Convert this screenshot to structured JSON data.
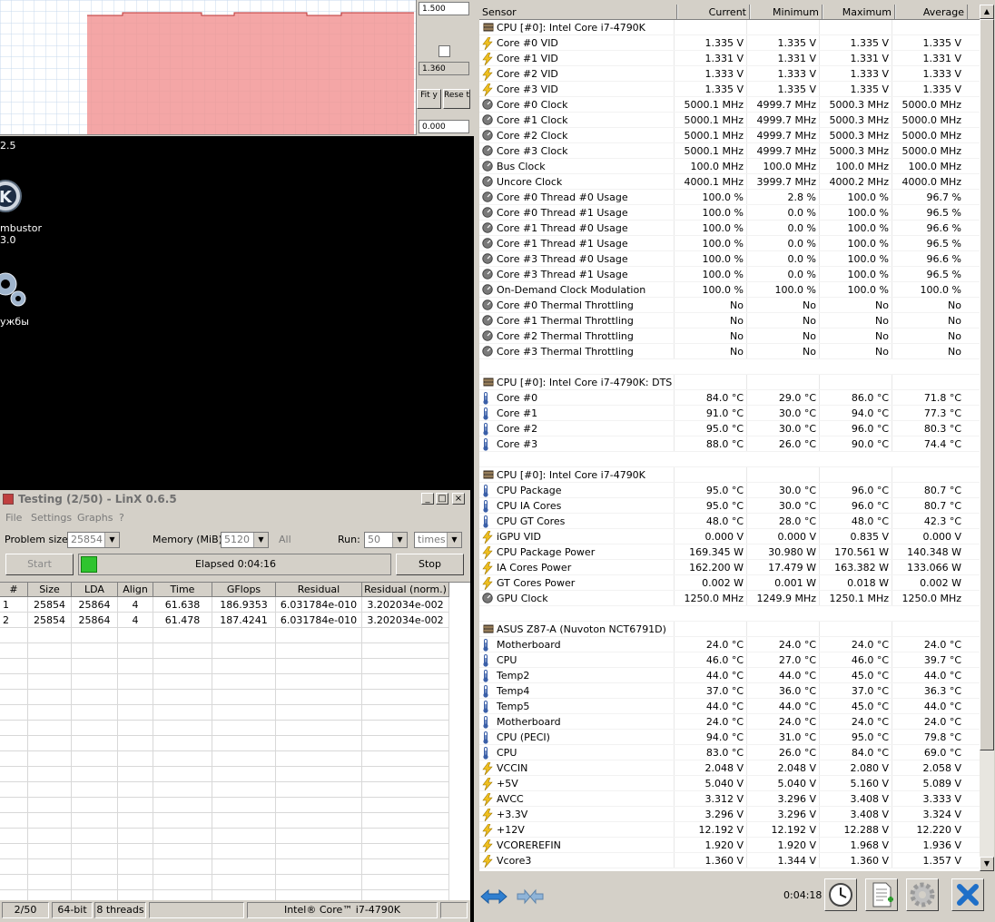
{
  "graph": {
    "top_value": "1.500",
    "current_value": "1.360",
    "bottom_value": "0.000",
    "fit_y_label": "Fit y",
    "reset_label": "Rese t"
  },
  "desktop": {
    "version_fragment": "2.5",
    "icon1_label_line1": "mbustor",
    "icon1_label_line2": "3.0",
    "icon2_label": "ужбы"
  },
  "linx": {
    "title": "Testing (2/50) - LinX 0.6.5",
    "menu": [
      "File",
      "Settings",
      "Graphs",
      "?"
    ],
    "problem_size_label": "Problem size:",
    "problem_size_value": "25854",
    "memory_label": "Memory (MiB):",
    "memory_value": "5120",
    "all_label": "All",
    "run_label": "Run:",
    "run_value": "50",
    "run_unit": "times",
    "start_label": "Start",
    "elapsed_label": "Elapsed 0:04:16",
    "stop_label": "Stop",
    "columns": [
      "#",
      "Size",
      "LDA",
      "Align",
      "Time",
      "GFlops",
      "Residual",
      "Residual (norm.)"
    ],
    "rows": [
      [
        "1",
        "25854",
        "25864",
        "4",
        "61.638",
        "186.9353",
        "6.031784e-010",
        "3.202034e-002"
      ],
      [
        "2",
        "25854",
        "25864",
        "4",
        "61.478",
        "187.4241",
        "6.031784e-010",
        "3.202034e-002"
      ]
    ],
    "status": {
      "progress": "2/50",
      "bits": "64-bit",
      "threads": "8 threads",
      "cpu": "Intel® Core™ i7-4790K"
    }
  },
  "hwinfo": {
    "columns": [
      "Sensor",
      "Current",
      "Minimum",
      "Maximum",
      "Average"
    ],
    "rows": [
      {
        "type": "group",
        "name": "CPU [#0]: Intel Core i7-4790K"
      },
      {
        "icon": "bolt",
        "name": "Core #0 VID",
        "v": [
          "1.335 V",
          "1.335 V",
          "1.335 V",
          "1.335 V"
        ]
      },
      {
        "icon": "bolt",
        "name": "Core #1 VID",
        "v": [
          "1.331 V",
          "1.331 V",
          "1.331 V",
          "1.331 V"
        ]
      },
      {
        "icon": "bolt",
        "name": "Core #2 VID",
        "v": [
          "1.333 V",
          "1.333 V",
          "1.333 V",
          "1.333 V"
        ]
      },
      {
        "icon": "bolt",
        "name": "Core #3 VID",
        "v": [
          "1.335 V",
          "1.335 V",
          "1.335 V",
          "1.335 V"
        ]
      },
      {
        "icon": "gauge",
        "name": "Core #0 Clock",
        "v": [
          "5000.1 MHz",
          "4999.7 MHz",
          "5000.3 MHz",
          "5000.0 MHz"
        ]
      },
      {
        "icon": "gauge",
        "name": "Core #1 Clock",
        "v": [
          "5000.1 MHz",
          "4999.7 MHz",
          "5000.3 MHz",
          "5000.0 MHz"
        ]
      },
      {
        "icon": "gauge",
        "name": "Core #2 Clock",
        "v": [
          "5000.1 MHz",
          "4999.7 MHz",
          "5000.3 MHz",
          "5000.0 MHz"
        ]
      },
      {
        "icon": "gauge",
        "name": "Core #3 Clock",
        "v": [
          "5000.1 MHz",
          "4999.7 MHz",
          "5000.3 MHz",
          "5000.0 MHz"
        ]
      },
      {
        "icon": "gauge",
        "name": "Bus Clock",
        "v": [
          "100.0 MHz",
          "100.0 MHz",
          "100.0 MHz",
          "100.0 MHz"
        ]
      },
      {
        "icon": "gauge",
        "name": "Uncore Clock",
        "v": [
          "4000.1 MHz",
          "3999.7 MHz",
          "4000.2 MHz",
          "4000.0 MHz"
        ]
      },
      {
        "icon": "gauge",
        "name": "Core #0 Thread #0 Usage",
        "v": [
          "100.0 %",
          "2.8 %",
          "100.0 %",
          "96.7 %"
        ]
      },
      {
        "icon": "gauge",
        "name": "Core #0 Thread #1 Usage",
        "v": [
          "100.0 %",
          "0.0 %",
          "100.0 %",
          "96.5 %"
        ]
      },
      {
        "icon": "gauge",
        "name": "Core #1 Thread #0 Usage",
        "v": [
          "100.0 %",
          "0.0 %",
          "100.0 %",
          "96.6 %"
        ]
      },
      {
        "icon": "gauge",
        "name": "Core #1 Thread #1 Usage",
        "v": [
          "100.0 %",
          "0.0 %",
          "100.0 %",
          "96.5 %"
        ]
      },
      {
        "icon": "gauge",
        "name": "Core #3 Thread #0 Usage",
        "v": [
          "100.0 %",
          "0.0 %",
          "100.0 %",
          "96.6 %"
        ]
      },
      {
        "icon": "gauge",
        "name": "Core #3 Thread #1 Usage",
        "v": [
          "100.0 %",
          "0.0 %",
          "100.0 %",
          "96.5 %"
        ]
      },
      {
        "icon": "gauge",
        "name": "On-Demand Clock Modulation",
        "v": [
          "100.0 %",
          "100.0 %",
          "100.0 %",
          "100.0 %"
        ]
      },
      {
        "icon": "gauge",
        "name": "Core #0 Thermal Throttling",
        "v": [
          "No",
          "No",
          "No",
          "No"
        ]
      },
      {
        "icon": "gauge",
        "name": "Core #1 Thermal Throttling",
        "v": [
          "No",
          "No",
          "No",
          "No"
        ]
      },
      {
        "icon": "gauge",
        "name": "Core #2 Thermal Throttling",
        "v": [
          "No",
          "No",
          "No",
          "No"
        ]
      },
      {
        "icon": "gauge",
        "name": "Core #3 Thermal Throttling",
        "v": [
          "No",
          "No",
          "No",
          "No"
        ]
      },
      {
        "type": "blank"
      },
      {
        "type": "group",
        "name": "CPU [#0]: Intel Core i7-4790K: DTS"
      },
      {
        "icon": "therm",
        "name": "Core #0",
        "v": [
          "84.0 °C",
          "29.0 °C",
          "86.0 °C",
          "71.8 °C"
        ]
      },
      {
        "icon": "therm",
        "name": "Core #1",
        "v": [
          "91.0 °C",
          "30.0 °C",
          "94.0 °C",
          "77.3 °C"
        ]
      },
      {
        "icon": "therm",
        "name": "Core #2",
        "v": [
          "95.0 °C",
          "30.0 °C",
          "96.0 °C",
          "80.3 °C"
        ]
      },
      {
        "icon": "therm",
        "name": "Core #3",
        "v": [
          "88.0 °C",
          "26.0 °C",
          "90.0 °C",
          "74.4 °C"
        ]
      },
      {
        "type": "blank"
      },
      {
        "type": "group",
        "name": "CPU [#0]: Intel Core i7-4790K"
      },
      {
        "icon": "therm",
        "name": "CPU Package",
        "v": [
          "95.0 °C",
          "30.0 °C",
          "96.0 °C",
          "80.7 °C"
        ]
      },
      {
        "icon": "therm",
        "name": "CPU IA Cores",
        "v": [
          "95.0 °C",
          "30.0 °C",
          "96.0 °C",
          "80.7 °C"
        ]
      },
      {
        "icon": "therm",
        "name": "CPU GT Cores",
        "v": [
          "48.0 °C",
          "28.0 °C",
          "48.0 °C",
          "42.3 °C"
        ]
      },
      {
        "icon": "bolt",
        "name": "iGPU VID",
        "v": [
          "0.000 V",
          "0.000 V",
          "0.835 V",
          "0.000 V"
        ]
      },
      {
        "icon": "bolt",
        "name": "CPU Package Power",
        "v": [
          "169.345 W",
          "30.980 W",
          "170.561 W",
          "140.348 W"
        ]
      },
      {
        "icon": "bolt",
        "name": "IA Cores Power",
        "v": [
          "162.200 W",
          "17.479 W",
          "163.382 W",
          "133.066 W"
        ]
      },
      {
        "icon": "bolt",
        "name": "GT Cores Power",
        "v": [
          "0.002 W",
          "0.001 W",
          "0.018 W",
          "0.002 W"
        ]
      },
      {
        "icon": "gauge",
        "name": "GPU Clock",
        "v": [
          "1250.0 MHz",
          "1249.9 MHz",
          "1250.1 MHz",
          "1250.0 MHz"
        ]
      },
      {
        "type": "blank"
      },
      {
        "type": "group",
        "name": "ASUS Z87-A (Nuvoton NCT6791D)"
      },
      {
        "icon": "therm",
        "name": "Motherboard",
        "v": [
          "24.0 °C",
          "24.0 °C",
          "24.0 °C",
          "24.0 °C"
        ]
      },
      {
        "icon": "therm",
        "name": "CPU",
        "v": [
          "46.0 °C",
          "27.0 °C",
          "46.0 °C",
          "39.7 °C"
        ]
      },
      {
        "icon": "therm",
        "name": "Temp2",
        "v": [
          "44.0 °C",
          "44.0 °C",
          "45.0 °C",
          "44.0 °C"
        ]
      },
      {
        "icon": "therm",
        "name": "Temp4",
        "v": [
          "37.0 °C",
          "36.0 °C",
          "37.0 °C",
          "36.3 °C"
        ]
      },
      {
        "icon": "therm",
        "name": "Temp5",
        "v": [
          "44.0 °C",
          "44.0 °C",
          "45.0 °C",
          "44.0 °C"
        ]
      },
      {
        "icon": "therm",
        "name": "Motherboard",
        "v": [
          "24.0 °C",
          "24.0 °C",
          "24.0 °C",
          "24.0 °C"
        ]
      },
      {
        "icon": "therm",
        "name": "CPU (PECI)",
        "v": [
          "94.0 °C",
          "31.0 °C",
          "95.0 °C",
          "79.8 °C"
        ]
      },
      {
        "icon": "therm",
        "name": "CPU",
        "v": [
          "83.0 °C",
          "26.0 °C",
          "84.0 °C",
          "69.0 °C"
        ]
      },
      {
        "icon": "bolt",
        "name": "VCCIN",
        "v": [
          "2.048 V",
          "2.048 V",
          "2.080 V",
          "2.058 V"
        ]
      },
      {
        "icon": "bolt",
        "name": "+5V",
        "v": [
          "5.040 V",
          "5.040 V",
          "5.160 V",
          "5.089 V"
        ]
      },
      {
        "icon": "bolt",
        "name": "AVCC",
        "v": [
          "3.312 V",
          "3.296 V",
          "3.408 V",
          "3.333 V"
        ]
      },
      {
        "icon": "bolt",
        "name": "+3.3V",
        "v": [
          "3.296 V",
          "3.296 V",
          "3.408 V",
          "3.324 V"
        ]
      },
      {
        "icon": "bolt",
        "name": "+12V",
        "v": [
          "12.192 V",
          "12.192 V",
          "12.288 V",
          "12.220 V"
        ]
      },
      {
        "icon": "bolt",
        "name": "VCOREREFIN",
        "v": [
          "1.920 V",
          "1.920 V",
          "1.968 V",
          "1.936 V"
        ]
      },
      {
        "icon": "bolt",
        "name": "Vcore3",
        "v": [
          "1.360 V",
          "1.344 V",
          "1.360 V",
          "1.357 V"
        ]
      }
    ],
    "elapsed": "0:04:18"
  }
}
